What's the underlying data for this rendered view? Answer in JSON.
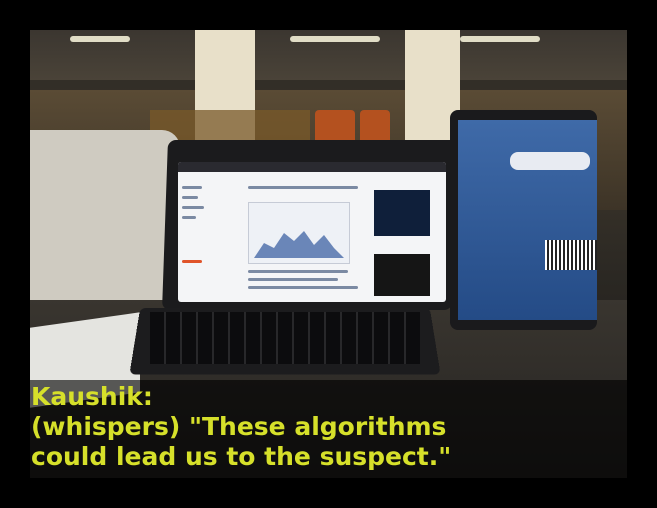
{
  "caption": {
    "speaker": "Kaushik:",
    "line1": "(whispers) \"These algorithms",
    "line2": "could lead us to the suspect.\""
  },
  "colors": {
    "caption_text": "#d6e02a",
    "caption_background": "rgba(0,0,0,0.62)",
    "frame_border": "#000000"
  }
}
